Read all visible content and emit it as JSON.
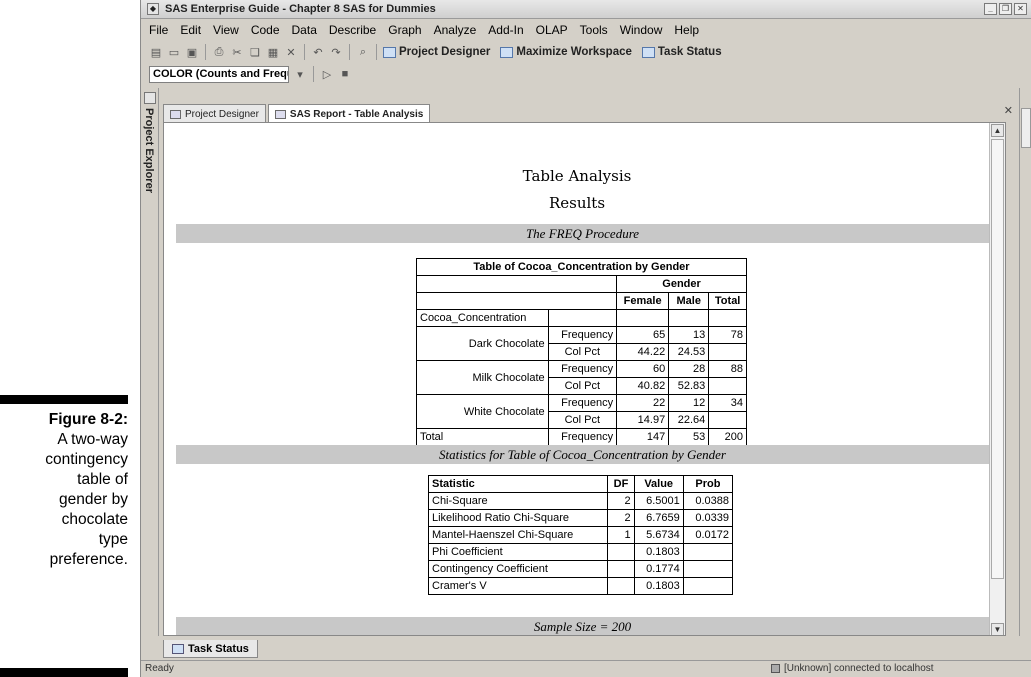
{
  "caption": {
    "figure_label": "Figure 8-2:",
    "text_lines": [
      "A two-way",
      "contingency",
      "table of",
      "gender by",
      "chocolate",
      "type",
      "preference."
    ]
  },
  "app": {
    "title": "SAS Enterprise Guide - Chapter 8 SAS for Dummies",
    "menu": [
      "File",
      "Edit",
      "View",
      "Code",
      "Data",
      "Describe",
      "Graph",
      "Analyze",
      "Add-In",
      "OLAP",
      "Tools",
      "Window",
      "Help"
    ],
    "toolbar": {
      "project_designer": "Project Designer",
      "maximize_workspace": "Maximize Workspace",
      "task_status": "Task Status"
    },
    "combo_value": "COLOR (Counts and Frequen",
    "side_left_label": "Project Explorer",
    "tabs": [
      "Project Designer",
      "SAS Report - Table Analysis"
    ],
    "task_status_tab": "Task Status",
    "status": {
      "ready": "Ready",
      "connection": "[Unknown] connected to localhost"
    }
  },
  "report": {
    "title": "Table Analysis",
    "subtitle": "Results",
    "proc_bar": "The FREQ Procedure",
    "freq_table": {
      "caption": "Table of Cocoa_Concentration by Gender",
      "col_group": "Gender",
      "columns": [
        "Female",
        "Male",
        "Total"
      ],
      "row_var": "Cocoa_Concentration",
      "rows": [
        {
          "label": "Dark Chocolate",
          "freq_label": "Frequency",
          "pct_label": "Col Pct",
          "freq": [
            "65",
            "13",
            "78"
          ],
          "pct": [
            "44.22",
            "24.53",
            ""
          ]
        },
        {
          "label": "Milk Chocolate",
          "freq_label": "Frequency",
          "pct_label": "Col Pct",
          "freq": [
            "60",
            "28",
            "88"
          ],
          "pct": [
            "40.82",
            "52.83",
            ""
          ]
        },
        {
          "label": "White Chocolate",
          "freq_label": "Frequency",
          "pct_label": "Col Pct",
          "freq": [
            "22",
            "12",
            "34"
          ],
          "pct": [
            "14.97",
            "22.64",
            ""
          ]
        }
      ],
      "total": {
        "label": "Total",
        "freq_label": "Frequency",
        "values": [
          "147",
          "53",
          "200"
        ]
      }
    },
    "stats_bar": "Statistics for Table of Cocoa_Concentration by Gender",
    "stats_table": {
      "headers": [
        "Statistic",
        "DF",
        "Value",
        "Prob"
      ],
      "rows": [
        [
          "Chi-Square",
          "2",
          "6.5001",
          "0.0388"
        ],
        [
          "Likelihood Ratio Chi-Square",
          "2",
          "6.7659",
          "0.0339"
        ],
        [
          "Mantel-Haenszel Chi-Square",
          "1",
          "5.6734",
          "0.0172"
        ],
        [
          "Phi Coefficient",
          "",
          "0.1803",
          ""
        ],
        [
          "Contingency Coefficient",
          "",
          "0.1774",
          ""
        ],
        [
          "Cramer's V",
          "",
          "0.1803",
          ""
        ]
      ]
    },
    "sample_bar": "Sample Size = 200"
  }
}
